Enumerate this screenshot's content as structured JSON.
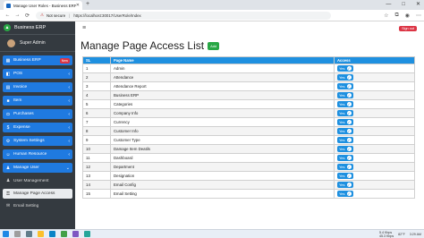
{
  "browser": {
    "tab_title": "Manage User Roles - Business ERP",
    "new_tab": "+",
    "back": "←",
    "forward": "→",
    "reload": "⟳",
    "security": "Not secure",
    "url": "https://localhost:30017/UserRole/Index",
    "minimize": "—",
    "maximize": "□",
    "close": "✕"
  },
  "sidebar": {
    "brand": "Business ERP",
    "user_name": "Super Admin",
    "items": [
      {
        "label": "Business ERP",
        "badge": "New"
      },
      {
        "label": "POS"
      },
      {
        "label": "Invoice"
      },
      {
        "label": "Item"
      },
      {
        "label": "Purchases"
      },
      {
        "label": "Expense"
      },
      {
        "label": "System Settings"
      },
      {
        "label": "Human Resource"
      },
      {
        "label": "Manage User"
      }
    ],
    "subitems": [
      {
        "label": "User Management"
      },
      {
        "label": "Manage Page Access"
      },
      {
        "label": "Email Setting"
      }
    ]
  },
  "topbar": {
    "menu_toggle": "≡",
    "signout": "Sign out"
  },
  "main": {
    "title": "Manage Page Access List",
    "add_button": "Add"
  },
  "table": {
    "headers": [
      "SL",
      "Page Name",
      "Access"
    ],
    "access_label": "Yes",
    "rows": [
      [
        "1",
        "Admin"
      ],
      [
        "2",
        "Attendance"
      ],
      [
        "3",
        "Attendance Report"
      ],
      [
        "4",
        "Business ERP"
      ],
      [
        "5",
        "Categories"
      ],
      [
        "6",
        "Company Info"
      ],
      [
        "7",
        "Currency"
      ],
      [
        "8",
        "Customer Info"
      ],
      [
        "9",
        "Customer Type"
      ],
      [
        "10",
        "Damage Item Deatils"
      ],
      [
        "11",
        "Dashboard"
      ],
      [
        "12",
        "Department"
      ],
      [
        "13",
        "Designation"
      ],
      [
        "14",
        "Email Config"
      ],
      [
        "15",
        "Email Setting"
      ]
    ]
  },
  "taskbar": {
    "net_up": "5.4 Kbps",
    "net_down": "45.3 Kbps",
    "weather": "82°F",
    "time": "3:29 AM"
  }
}
